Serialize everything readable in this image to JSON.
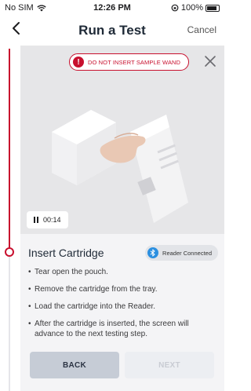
{
  "status_bar": {
    "carrier": "No SIM",
    "time": "12:26 PM",
    "battery": "100%"
  },
  "nav": {
    "title": "Run a Test",
    "cancel_label": "Cancel"
  },
  "video": {
    "warning_text": "DO NOT INSERT SAMPLE WAND",
    "warning_icon": "!",
    "timer": "00:14"
  },
  "step": {
    "title": "Insert Cartridge",
    "reader_status": "Reader Connected",
    "instructions": [
      "Tear open the pouch.",
      "Remove the cartridge from the tray.",
      "Load the cartridge into the Reader.",
      "After the cartridge is inserted, the screen will advance to the next testing step."
    ]
  },
  "buttons": {
    "back_label": "BACK",
    "next_label": "NEXT"
  },
  "colors": {
    "accent_red": "#c8102e",
    "reader_blue": "#2b8fe0",
    "back_button": "#c6ccd6",
    "next_button_disabled": "#eceef2"
  }
}
